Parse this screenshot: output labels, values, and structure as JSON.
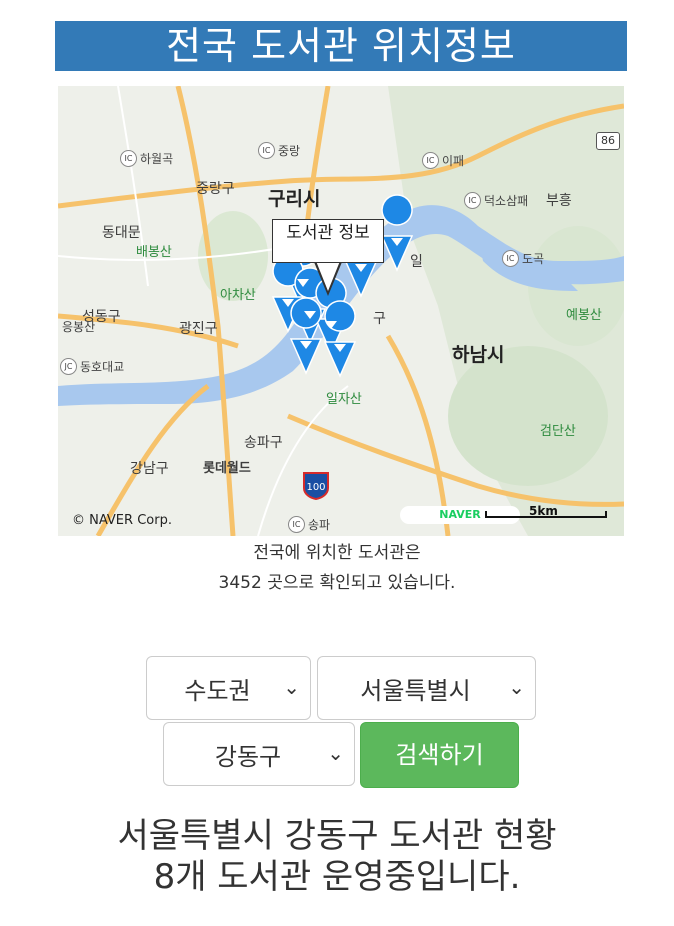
{
  "header": {
    "title": "전국 도서관 위치정보"
  },
  "map": {
    "info_window": "도서관 정보",
    "copyright": "© NAVER Corp.",
    "brand": "NAVER",
    "scale_label": "5km",
    "route_shields": [
      "86",
      "100"
    ],
    "labels": {
      "guri": "구리시",
      "hanam": "하남시",
      "jungnang": "중랑구",
      "gwangjin": "광진구",
      "songpa": "송파구",
      "gangnam": "강남구",
      "dongdaemun": "동대문",
      "seongdong": "성동구",
      "eungbong": "응봉산",
      "lotteworld": "롯데월드",
      "gu": "구",
      "il": "일",
      "baebongsan": "배봉산",
      "achasan": "아차산",
      "iljasan": "일자산",
      "yebongsan": "예봉산",
      "geomdansan": "검단산",
      "bubal": "부흥"
    },
    "ic_labels": [
      "하월곡",
      "중랑",
      "이패",
      "덕소삼패",
      "도곡",
      "동호대교",
      "송파"
    ],
    "marker_count": 8
  },
  "summary": {
    "line1": "전국에 위치한 도서관은",
    "line2": "3452 곳으로 확인되고 있습니다."
  },
  "filters": {
    "region": "수도권",
    "city": "서울특별시",
    "district": "강동구",
    "search_button": "검색하기"
  },
  "result": {
    "line1": "서울특별시 강동구 도서관 현황",
    "line2": "8개 도서관 운영중입니다."
  },
  "colors": {
    "header_bg": "#337ab7",
    "button_bg": "#5cb85c",
    "marker": "#1e88e5",
    "river": "#a8c8ee"
  }
}
